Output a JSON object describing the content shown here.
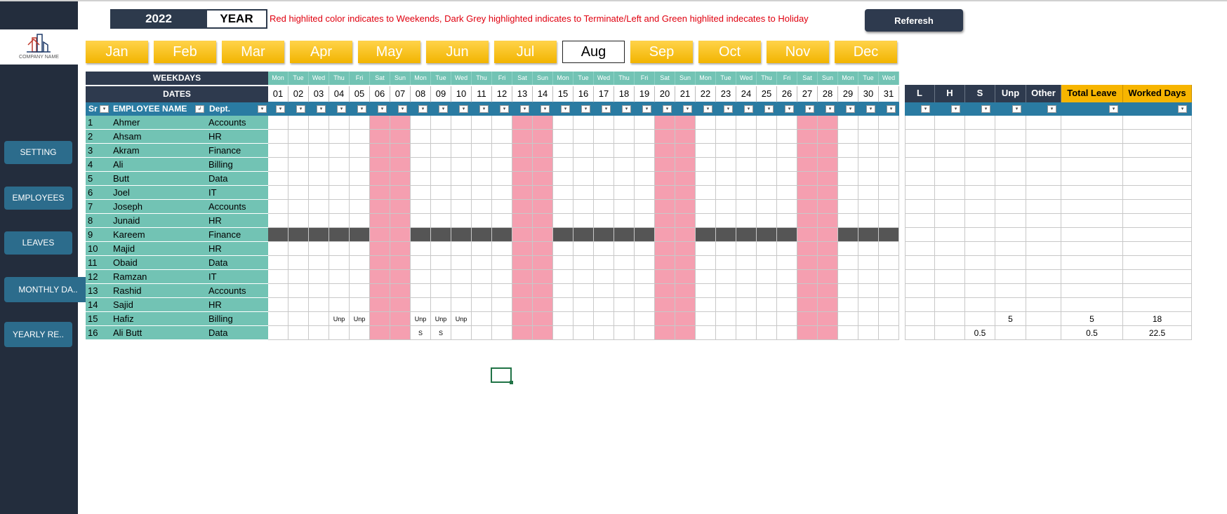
{
  "year": "2022",
  "year_label": "YEAR",
  "legend_note": "Red highlited color indicates to Weekends, Dark Grey highlighted indicates to Terminate/Left and Green highlited indecates to Holiday",
  "refresh_label": "Referesh",
  "company_name": "COMPANY NAME",
  "nav": [
    {
      "label": "SETTING"
    },
    {
      "label": "EMPLOYEES"
    },
    {
      "label": "LEAVES"
    },
    {
      "label": "MONTHLY DA.."
    },
    {
      "label": "YEARLY RE.."
    }
  ],
  "months": [
    "Jan",
    "Feb",
    "Mar",
    "Apr",
    "May",
    "Jun",
    "Jul",
    "Aug",
    "Sep",
    "Oct",
    "Nov",
    "Dec"
  ],
  "active_month": "Aug",
  "headers": {
    "weekdays": "WEEKDAYS",
    "dates": "DATES",
    "sr": "Sr",
    "name": "EMPLOYEE NAME",
    "dept": "Dept."
  },
  "weekdays": [
    "Mon",
    "Tue",
    "Wed",
    "Thu",
    "Fri",
    "Sat",
    "Sun",
    "Mon",
    "Tue",
    "Wed",
    "Thu",
    "Fri",
    "Sat",
    "Sun",
    "Mon",
    "Tue",
    "Wed",
    "Thu",
    "Fri",
    "Sat",
    "Sun",
    "Mon",
    "Tue",
    "Wed",
    "Thu",
    "Fri",
    "Sat",
    "Sun",
    "Mon",
    "Tue",
    "Wed"
  ],
  "dates": [
    "01",
    "02",
    "03",
    "04",
    "05",
    "06",
    "07",
    "08",
    "09",
    "10",
    "11",
    "12",
    "13",
    "14",
    "15",
    "16",
    "17",
    "18",
    "19",
    "20",
    "21",
    "22",
    "23",
    "24",
    "25",
    "26",
    "27",
    "28",
    "29",
    "30",
    "31"
  ],
  "weekend_dates": [
    "06",
    "07",
    "13",
    "14",
    "20",
    "21",
    "27",
    "28"
  ],
  "summary_headers": [
    "L",
    "H",
    "S",
    "Unp",
    "Other",
    "Total Leave",
    "Worked Days"
  ],
  "employees": [
    {
      "sr": "1",
      "name": "Ahmer",
      "dept": "Accounts",
      "days": {},
      "summary": [
        "",
        "",
        "",
        "",
        "",
        "",
        ""
      ]
    },
    {
      "sr": "2",
      "name": "Ahsam",
      "dept": "HR",
      "days": {},
      "summary": [
        "",
        "",
        "",
        "",
        "",
        "",
        ""
      ]
    },
    {
      "sr": "3",
      "name": "Akram",
      "dept": "Finance",
      "days": {},
      "summary": [
        "",
        "",
        "",
        "",
        "",
        "",
        ""
      ]
    },
    {
      "sr": "4",
      "name": "Ali",
      "dept": "Billing",
      "days": {},
      "summary": [
        "",
        "",
        "",
        "",
        "",
        "",
        ""
      ]
    },
    {
      "sr": "5",
      "name": "Butt",
      "dept": "Data",
      "days": {},
      "summary": [
        "",
        "",
        "",
        "",
        "",
        "",
        ""
      ]
    },
    {
      "sr": "6",
      "name": "Joel",
      "dept": "IT",
      "days": {},
      "summary": [
        "",
        "",
        "",
        "",
        "",
        "",
        ""
      ]
    },
    {
      "sr": "7",
      "name": "Joseph",
      "dept": "Accounts",
      "days": {},
      "summary": [
        "",
        "",
        "",
        "",
        "",
        "",
        ""
      ]
    },
    {
      "sr": "8",
      "name": "Junaid",
      "dept": "HR",
      "days": {},
      "summary": [
        "",
        "",
        "",
        "",
        "",
        "",
        ""
      ]
    },
    {
      "sr": "9",
      "name": "Kareem",
      "dept": "Finance",
      "terminated": true,
      "days": {},
      "summary": [
        "",
        "",
        "",
        "",
        "",
        "",
        ""
      ]
    },
    {
      "sr": "10",
      "name": "Majid",
      "dept": "HR",
      "days": {},
      "summary": [
        "",
        "",
        "",
        "",
        "",
        "",
        ""
      ]
    },
    {
      "sr": "11",
      "name": "Obaid",
      "dept": "Data",
      "days": {},
      "summary": [
        "",
        "",
        "",
        "",
        "",
        "",
        ""
      ]
    },
    {
      "sr": "12",
      "name": "Ramzan",
      "dept": "IT",
      "days": {},
      "summary": [
        "",
        "",
        "",
        "",
        "",
        "",
        ""
      ]
    },
    {
      "sr": "13",
      "name": "Rashid",
      "dept": "Accounts",
      "days": {},
      "summary": [
        "",
        "",
        "",
        "",
        "",
        "",
        ""
      ]
    },
    {
      "sr": "14",
      "name": "Sajid",
      "dept": "HR",
      "days": {},
      "summary": [
        "",
        "",
        "",
        "",
        "",
        "",
        ""
      ]
    },
    {
      "sr": "15",
      "name": "Hafiz",
      "dept": "Billing",
      "days": {
        "04": "Unp",
        "05": "Unp",
        "08": "Unp",
        "09": "Unp",
        "10": "Unp"
      },
      "summary": [
        "",
        "",
        "",
        "5",
        "",
        "5",
        "18"
      ]
    },
    {
      "sr": "16",
      "name": "Ali Butt",
      "dept": "Data",
      "days": {
        "08": "S",
        "09": "S"
      },
      "summary": [
        "",
        "",
        "0.5",
        "",
        "",
        "0.5",
        "22.5"
      ]
    }
  ],
  "colors": {
    "teal": "#72c3b4",
    "weekend": "#f59fb0",
    "terminated": "#555555",
    "header_dark": "#2e3a4e",
    "filter_blue": "#2a7ba2",
    "month_gold": "#f7b500"
  }
}
